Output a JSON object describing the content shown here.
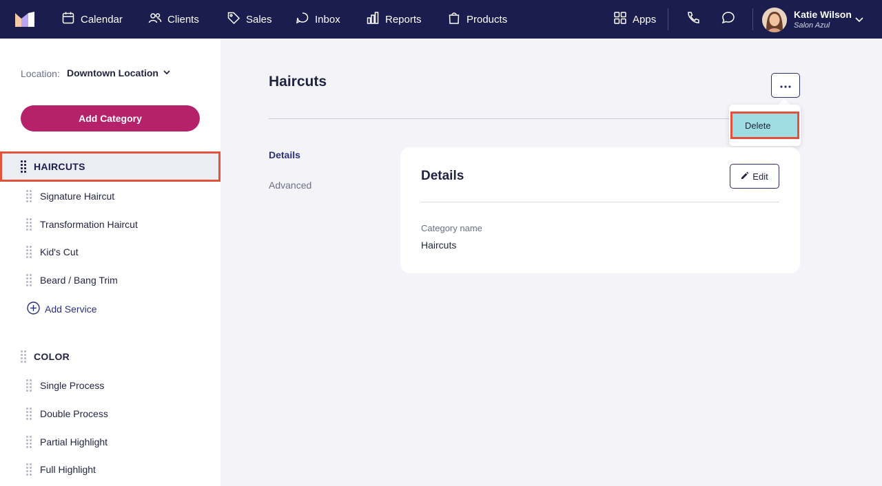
{
  "nav": {
    "items": [
      {
        "label": "Calendar",
        "icon": "calendar-icon"
      },
      {
        "label": "Clients",
        "icon": "clients-icon"
      },
      {
        "label": "Sales",
        "icon": "tag-icon"
      },
      {
        "label": "Inbox",
        "icon": "inbox-icon"
      },
      {
        "label": "Reports",
        "icon": "chart-icon"
      },
      {
        "label": "Products",
        "icon": "bag-icon"
      }
    ],
    "apps_label": "Apps",
    "user": {
      "name": "Katie Wilson",
      "salon": "Salon Azul"
    }
  },
  "sidebar": {
    "location_label": "Location:",
    "location_value": "Downtown Location",
    "add_category_label": "Add Category",
    "categories": [
      {
        "name": "HAIRCUTS",
        "services": [
          "Signature Haircut",
          "Transformation Haircut",
          "Kid's Cut",
          "Beard / Bang Trim"
        ]
      },
      {
        "name": "COLOR",
        "services": [
          "Single Process",
          "Double Process",
          "Partial Highlight",
          "Full Highlight"
        ]
      }
    ],
    "add_service_label": "Add Service"
  },
  "main": {
    "title": "Haircuts",
    "menu": {
      "delete_label": "Delete"
    },
    "tabs": [
      "Details",
      "Advanced"
    ],
    "card": {
      "title": "Details",
      "edit_label": "Edit",
      "field_label": "Category name",
      "field_value": "Haircuts"
    }
  },
  "colors": {
    "nav_bg": "#1a1d4d",
    "primary_button": "#b5226b",
    "highlight_outline": "#e2513b",
    "menu_hover": "#9fdde2"
  }
}
